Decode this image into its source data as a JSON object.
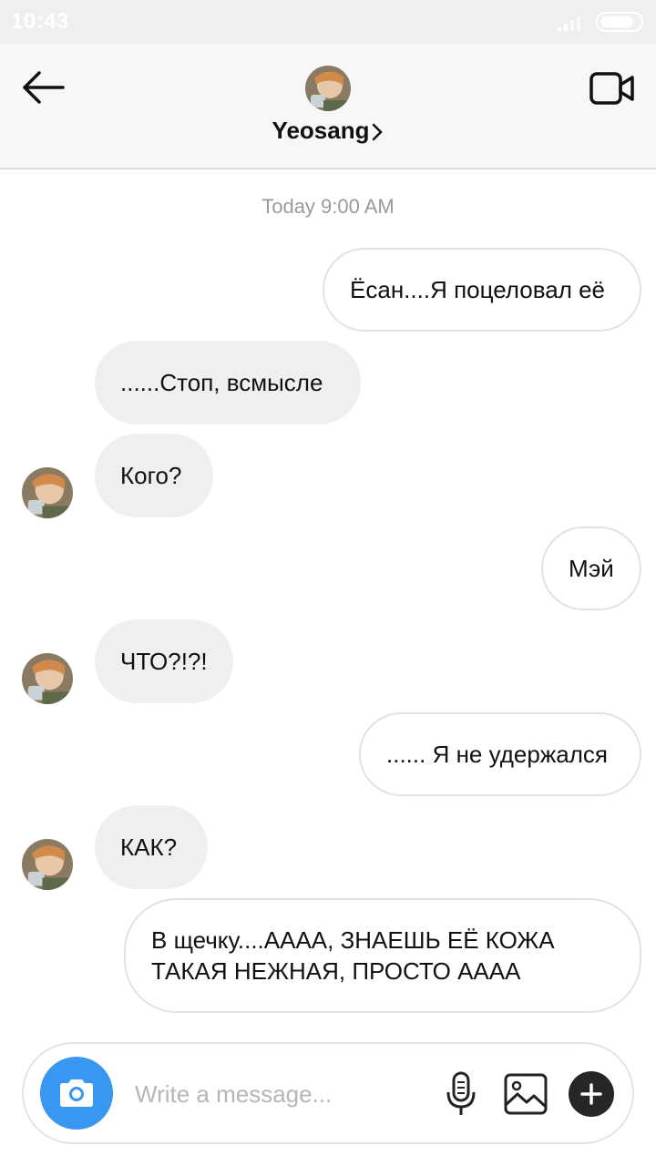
{
  "status_bar": {
    "time": "10:43",
    "icons": [
      "signal-icon",
      "battery-icon"
    ],
    "battery_level": 0.85
  },
  "header": {
    "contact_name": "Yeosang",
    "icons": [
      "back-arrow-icon",
      "video-call-icon",
      "chevron-right-icon"
    ]
  },
  "conversation": {
    "timestamp": "Today 9:00 AM",
    "messages": [
      {
        "direction": "outgoing",
        "text": "Ёсан....Я поцеловал её"
      },
      {
        "direction": "incoming",
        "text": "......Стоп, всмысле"
      },
      {
        "direction": "incoming",
        "text": "Кого?"
      },
      {
        "direction": "outgoing",
        "text": "Мэй"
      },
      {
        "direction": "incoming",
        "text": "ЧТО?!?!"
      },
      {
        "direction": "outgoing",
        "text": "...... Я не удержался"
      },
      {
        "direction": "incoming",
        "text": "КАК?"
      },
      {
        "direction": "outgoing",
        "text": "В щечку....АААА, ЗНАЕШЬ ЕЁ КОЖА ТАКАЯ НЕЖНАЯ, ПРОСТО АААА"
      }
    ]
  },
  "composer": {
    "placeholder": "Write a message...",
    "icons": [
      "camera-icon",
      "microphone-icon",
      "gallery-icon",
      "plus-icon"
    ]
  },
  "colors": {
    "accent": "#3897f0",
    "incoming_bubble": "#efefef",
    "outgoing_border": "#e2e2e2"
  }
}
